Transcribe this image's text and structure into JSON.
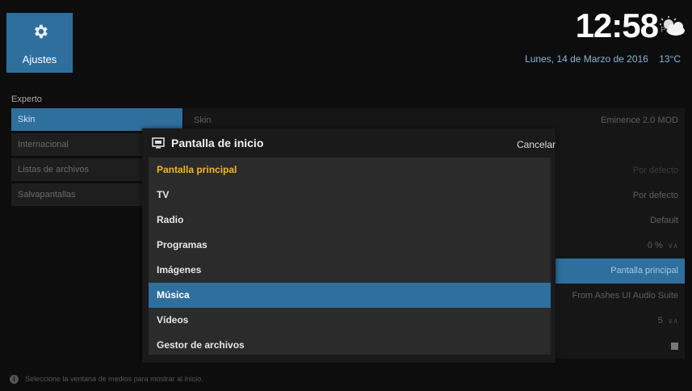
{
  "tile": {
    "label": "Ajustes",
    "icon": "gear-icon"
  },
  "clock": {
    "time": "12:58",
    "ampm": "PM",
    "date": "Lunes, 14 de Marzo de 2016",
    "temp": "13°C",
    "weather_icon": "partly-cloudy-icon"
  },
  "section_title": "Experto",
  "categories": [
    {
      "label": "Skin",
      "active": true
    },
    {
      "label": "Internacional"
    },
    {
      "label": "Listas de archivos"
    },
    {
      "label": "Salvapantallas"
    }
  ],
  "settings": {
    "skin_label": "Skin",
    "skin_value": "Eminence 2.0 MOD",
    "row2_value": "Por defecto",
    "row3_value": "Por defecto",
    "row4_value": "Default",
    "row5_value": "0 %",
    "row6_value": "Pantalla principal",
    "row7_value": "From Ashes UI Audio Suite",
    "row8_value": "5",
    "spin_glyph": "∨∧"
  },
  "dialog": {
    "title": "Pantalla de inicio",
    "cancel": "Cancelar",
    "options": [
      "Pantalla principal",
      "TV",
      "Radio",
      "Programas",
      "Imágenes",
      "Música",
      "Vídeos",
      "Gestor de archivos"
    ]
  },
  "footer": {
    "icon": "info-icon",
    "text": "Seleccione la ventana de medios para mostrar al inicio."
  },
  "colors": {
    "accent": "#2e6f9e",
    "highlight": "#f0b428",
    "background": "#0d0d0d"
  }
}
